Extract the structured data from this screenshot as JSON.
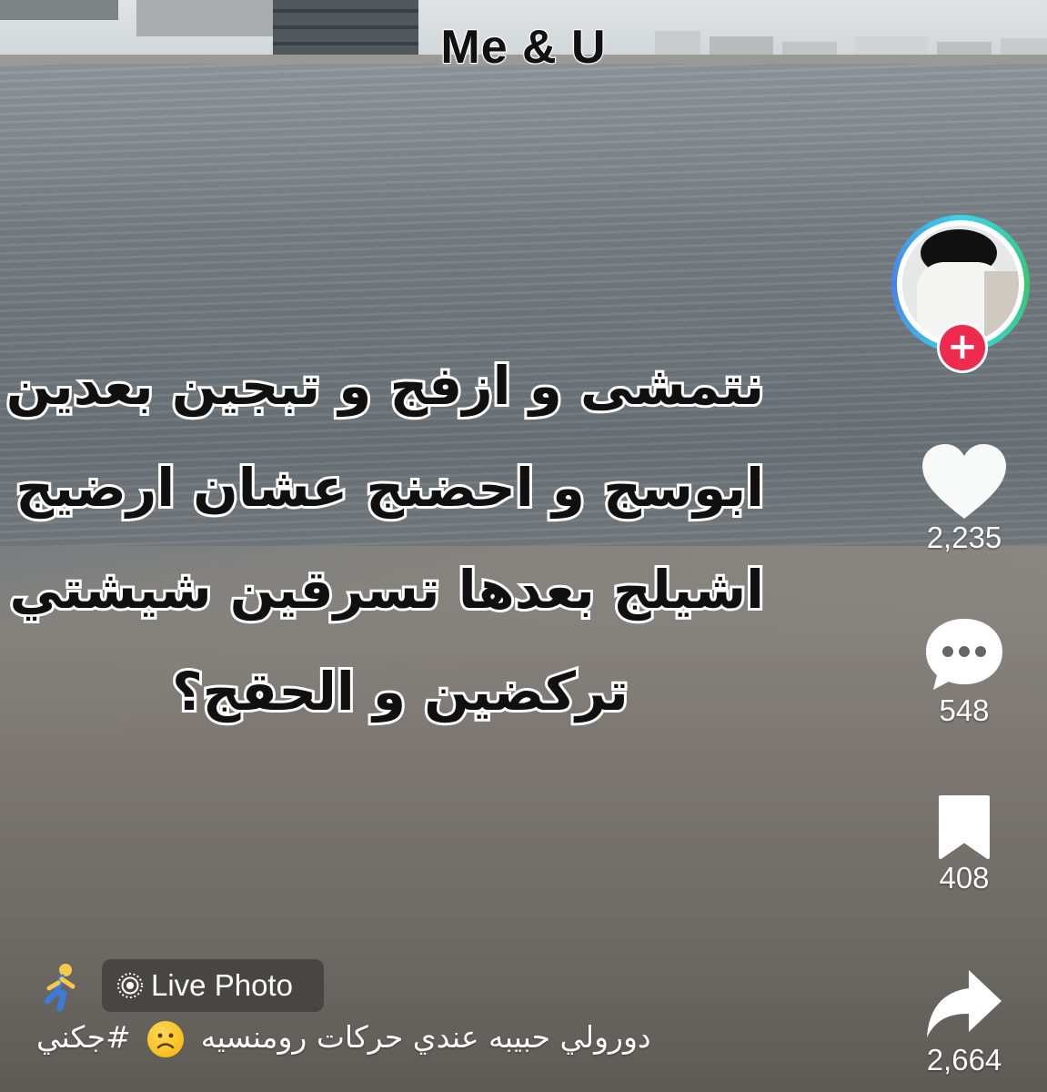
{
  "video": {
    "top_title": "Me & U",
    "overlay_lines": [
      "نتمشى و ازفج و تبجين بعدين",
      "ابوسج و احضنج عشان ارضيج و",
      "اشيلج بعدها تسرقين شيشتي و",
      "تركضين و الحقج؟"
    ]
  },
  "actions": {
    "likes": "2,235",
    "comments": "548",
    "saves": "408",
    "shares": "2,664",
    "follow_symbol": "+"
  },
  "bottom": {
    "live_photo_label": "Live Photo",
    "caption_text": "دورولي حبيبه عندي حركات رومنسيه",
    "caption_hashtag": "#جكني"
  },
  "icons": {
    "follow": "plus-icon",
    "like": "heart-icon",
    "comment": "comment-bubble-icon",
    "save": "bookmark-icon",
    "share": "share-arrow-icon",
    "live": "live-photo-icon",
    "runner": "runner-emoji-icon",
    "frown": "frowning-face-emoji-icon"
  },
  "colors": {
    "follow_button": "#ee2b4f",
    "ring_gradient": [
      "#3ad4e8",
      "#39c56f",
      "#4c7ee8"
    ]
  }
}
